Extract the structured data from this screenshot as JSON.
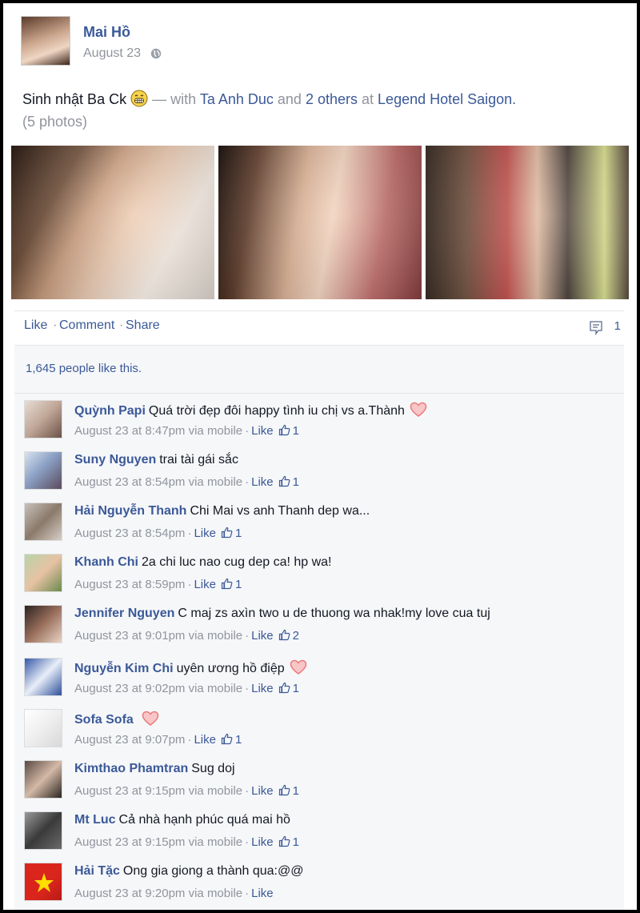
{
  "post": {
    "author": "Mai Hồ",
    "date": "August 23",
    "text_main": "Sinh nhật Ba Ck",
    "text_with": "— with",
    "tag1": "Ta Anh Duc",
    "text_and": "and",
    "tag2": "2 others",
    "text_at": "at",
    "place": "Legend Hotel Saigon.",
    "photos_label": "(5 photos)"
  },
  "actions": {
    "like": "Like",
    "comment": "Comment",
    "share": "Share",
    "separator": "·",
    "comment_count": "1"
  },
  "likes_text": "1,645 people like this.",
  "colors": {
    "link": "#3b5998",
    "muted": "#90949c",
    "heart": "#e9797c"
  },
  "comments": [
    {
      "name": "Quỳnh Papi",
      "text": "Quá trời đẹp đôi happy tình iu chị vs a.Thành",
      "heart": true,
      "time": "August 23 at 8:47pm via mobile",
      "like": "Like",
      "count": "1"
    },
    {
      "name": "Suny Nguyen",
      "text": "trai tài gái sắc",
      "heart": false,
      "time": "August 23 at 8:54pm via mobile",
      "like": "Like",
      "count": "1"
    },
    {
      "name": "Hải Nguyễn Thanh",
      "text": "Chi Mai vs anh Thanh dep wa...",
      "heart": false,
      "time": "August 23 at 8:54pm",
      "like": "Like",
      "count": "1"
    },
    {
      "name": "Khanh Chi",
      "text": "2a chi luc nao cug dep ca! hp wa!",
      "heart": false,
      "time": "August 23 at 8:59pm",
      "like": "Like",
      "count": "1"
    },
    {
      "name": "Jennifer Nguyen",
      "text": "C maj zs axìn two u de thuong wa nhak!my love cua tuj",
      "heart": false,
      "time": "August 23 at 9:01pm via mobile",
      "like": "Like",
      "count": "2"
    },
    {
      "name": "Nguyễn Kim Chi",
      "text": "uyên ương hồ điệp",
      "heart": true,
      "time": "August 23 at 9:02pm via mobile",
      "like": "Like",
      "count": "1"
    },
    {
      "name": "Sofa Sofa",
      "text": "",
      "heart": true,
      "time": "August 23 at 9:07pm",
      "like": "Like",
      "count": "1"
    },
    {
      "name": "Kimthao Phamtran",
      "text": "Sug doj",
      "heart": false,
      "time": "August 23 at 9:15pm via mobile",
      "like": "Like",
      "count": "1"
    },
    {
      "name": "Mt Luc",
      "text": "Cả nhà hạnh phúc quá mai hồ",
      "heart": false,
      "time": "August 23 at 9:15pm via mobile",
      "like": "Like",
      "count": "1"
    },
    {
      "name": "Hải Tặc",
      "text": "Ong gia giong a thành qua:@@",
      "heart": false,
      "time": "August 23 at 9:20pm via mobile",
      "like": "Like",
      "count": ""
    }
  ]
}
